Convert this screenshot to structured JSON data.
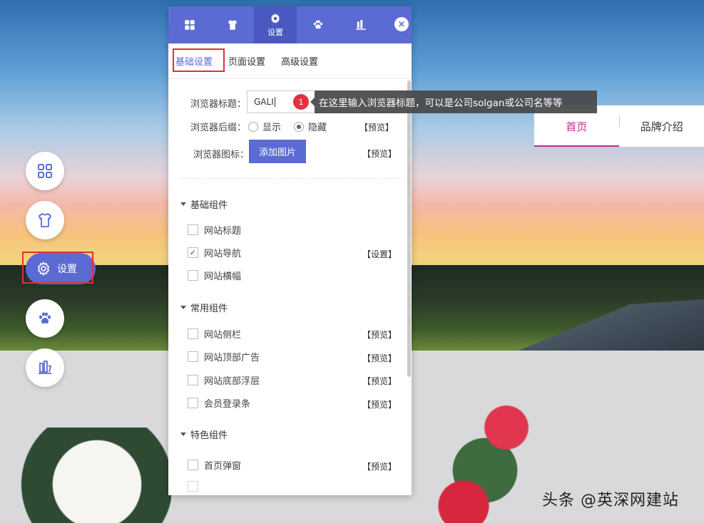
{
  "site_nav": {
    "items": [
      {
        "label": "首页",
        "active": true
      },
      {
        "label": "品牌介绍",
        "active": false
      }
    ]
  },
  "left_toolbar": {
    "items": [
      {
        "icon": "grid-icon"
      },
      {
        "icon": "tshirt-icon"
      },
      {
        "icon": "gear-icon",
        "label": "设置",
        "active": true
      },
      {
        "icon": "paw-icon"
      },
      {
        "icon": "component-icon"
      }
    ]
  },
  "panel": {
    "header_tabs": [
      {
        "icon": "grid-icon",
        "label": ""
      },
      {
        "icon": "tshirt-icon",
        "label": ""
      },
      {
        "icon": "gear-icon",
        "label": "设置",
        "active": true
      },
      {
        "icon": "paw-icon",
        "label": ""
      },
      {
        "icon": "component-icon",
        "label": ""
      }
    ],
    "close_label": "×",
    "subtabs": [
      "基础设置",
      "页面设置",
      "高级设置"
    ],
    "browser_title_label": "浏览器标题：",
    "browser_title_value": "GALI",
    "browser_suffix_label": "浏览器后缀：",
    "suffix_options": [
      "显示",
      "隐藏"
    ],
    "suffix_selected": "隐藏",
    "preview_label": "【预览】",
    "browser_icon_label": "浏览器图标：",
    "add_image_label": "添加图片",
    "sections": [
      {
        "title": "基础组件",
        "items": [
          {
            "label": "网站标题",
            "checked": false,
            "action": ""
          },
          {
            "label": "网站导航",
            "checked": true,
            "action": "【设置】"
          },
          {
            "label": "网站横幅",
            "checked": false,
            "action": ""
          }
        ]
      },
      {
        "title": "常用组件",
        "items": [
          {
            "label": "网站侧栏",
            "checked": false,
            "action": "【预览】"
          },
          {
            "label": "网站顶部广告",
            "checked": false,
            "action": "【预览】"
          },
          {
            "label": "网站底部浮层",
            "checked": false,
            "action": "【预览】"
          },
          {
            "label": "会员登录条",
            "checked": false,
            "action": "【预览】"
          }
        ]
      },
      {
        "title": "特色组件",
        "items": [
          {
            "label": "首页弹窗",
            "checked": false,
            "action": "【预览】"
          }
        ]
      }
    ]
  },
  "tooltip": {
    "badge": "1",
    "text": "在这里输入浏览器标题，可以是公司solgan或公司名等等"
  },
  "watermark": "头条 @英深网建站",
  "colors": {
    "accent": "#5b6bd3",
    "highlight_red": "#e0303a",
    "nav_active": "#c2288f"
  }
}
